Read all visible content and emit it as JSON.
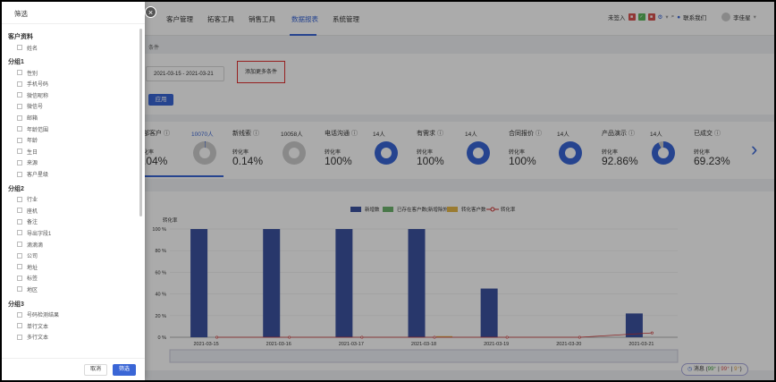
{
  "nav": {
    "items": [
      "客户管理",
      "拓客工具",
      "销售工具",
      "数据报表",
      "系统管理"
    ],
    "active_index": 3,
    "right": {
      "checkin": "未签入",
      "contact": "联系我们",
      "user": "李佳星"
    }
  },
  "breadcrumb": "条件",
  "filter_bar": {
    "date_range": "2021-03-15 - 2021-03-21",
    "add_condition": "添加更多条件",
    "apply": "应用"
  },
  "stats": [
    {
      "title": "部客户",
      "count": "10070人",
      "rate_label": "化率",
      "rate": ".04%",
      "donut_percent": null
    },
    {
      "title": "新线索",
      "count": "10058人",
      "rate_label": "转化率",
      "rate": "0.14%",
      "donut_percent": 0.14
    },
    {
      "title": "电话沟通",
      "count": "14人",
      "rate_label": "转化率",
      "rate": "100%",
      "donut_percent": 100
    },
    {
      "title": "有需求",
      "count": "14人",
      "rate_label": "转化率",
      "rate": "100%",
      "donut_percent": 100
    },
    {
      "title": "合同报价",
      "count": "14人",
      "rate_label": "转化率",
      "rate": "100%",
      "donut_percent": 100
    },
    {
      "title": "产品演示",
      "count": "14人",
      "rate_label": "转化率",
      "rate": "92.86%",
      "donut_percent": 92.86
    },
    {
      "title": "已成交",
      "count": "",
      "rate_label": "转化率",
      "rate": "69.23%",
      "donut_percent": null
    }
  ],
  "chart_data": {
    "type": "bar",
    "categories": [
      "2021-03-15",
      "2021-03-16",
      "2021-03-17",
      "2021-03-18",
      "2021-03-19",
      "2021-03-20",
      "2021-03-21"
    ],
    "series": [
      {
        "name": "新增数",
        "color": "#3c52a0",
        "values": [
          100,
          100,
          100,
          100,
          45,
          0,
          22
        ]
      },
      {
        "name": "已存在客户数(新增除外)",
        "color": "#6db36d",
        "values": [
          0,
          0,
          0,
          0,
          0,
          0,
          0
        ]
      },
      {
        "name": "转化客户数",
        "color": "#e6b84a",
        "values": [
          0,
          0,
          0,
          1,
          0,
          0,
          0
        ]
      },
      {
        "name": "转化率",
        "color": "#cc3333",
        "values": [
          0,
          0,
          0,
          0,
          0,
          0,
          4
        ]
      }
    ],
    "ylabel": "转化率",
    "yticks": [
      "0 %",
      "20 %",
      "40 %",
      "60 %",
      "80 %",
      "100 %"
    ],
    "ylim": [
      0,
      100
    ]
  },
  "drawer": {
    "title": "筛选",
    "sections": [
      {
        "title": "客户资料",
        "items": [
          "姓名"
        ]
      },
      {
        "title": "分组1",
        "items": [
          "性别",
          "手机号码",
          "微信昵称",
          "微信号",
          "邮箱",
          "年龄范围",
          "年龄",
          "生日",
          "来源",
          "客户星级"
        ]
      },
      {
        "title": "分组2",
        "items": [
          "行业",
          "座机",
          "备注",
          "导出字段1",
          "滴滴滴",
          "公司",
          "地址",
          "标签",
          "地区"
        ]
      },
      {
        "title": "分组3",
        "items": [
          "号码检测结果",
          "单行文本",
          "多行文本"
        ]
      }
    ],
    "cancel": "取消",
    "filter": "筛选"
  },
  "message_chip": {
    "label": "消息",
    "a": "99⁺",
    "b": "99⁺",
    "c": "9⁺"
  },
  "colors": {
    "accent": "#3a66d6",
    "highlight_border": "#e03030"
  }
}
